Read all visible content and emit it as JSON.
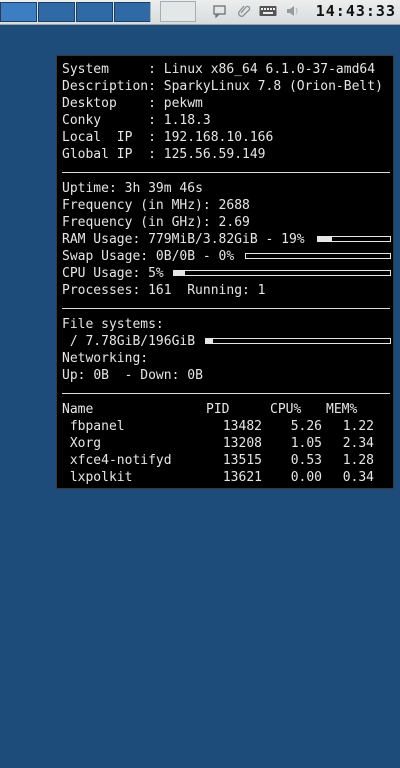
{
  "panel": {
    "clock": "14:43:33",
    "desktops": 4
  },
  "conky": {
    "system": [
      {
        "label": "System     : ",
        "value": "Linux x86_64 6.1.0-37-amd64"
      },
      {
        "label": "Description: ",
        "value": "SparkyLinux 7.8 (Orion-Belt)"
      },
      {
        "label": "Desktop    : ",
        "value": "pekwm"
      },
      {
        "label": "Conky      : ",
        "value": "1.18.3"
      },
      {
        "label": "Local  IP  : ",
        "value": "192.168.10.166"
      },
      {
        "label": "Global IP  : ",
        "value": "125.56.59.149"
      }
    ],
    "uptime": {
      "label": "Uptime: ",
      "value": "3h 39m 46s"
    },
    "freq_mhz": {
      "label": "Frequency (in MHz): ",
      "value": "2688"
    },
    "freq_ghz": {
      "label": "Frequency (in GHz): ",
      "value": "2.69"
    },
    "ram": {
      "label": "RAM Usage: ",
      "value": "779MiB/3.82GiB - 19%",
      "fraction": 0.19
    },
    "swap": {
      "label": "Swap Usage: ",
      "value": "0B/0B - 0%",
      "fraction": 0.0
    },
    "cpu": {
      "label": "CPU Usage: ",
      "value": "5%",
      "fraction": 0.05
    },
    "processes": {
      "label": "Processes: ",
      "value": "161",
      "running_label": "  Running: ",
      "running_value": "1"
    },
    "filesystems": {
      "heading": "File systems:",
      "root_label": " / ",
      "root_value": "7.78GiB/196GiB",
      "fraction": 0.04
    },
    "networking": {
      "heading": "Networking:",
      "up_label": "Up: ",
      "up_value": "0B",
      "down_label": "  - Down: ",
      "down_value": "0B"
    },
    "top": {
      "headers": {
        "name": "Name",
        "pid": "PID",
        "cpu": "CPU%",
        "mem": "MEM%"
      },
      "rows": [
        {
          "name": " fbpanel",
          "pid": "13482",
          "cpu": "5.26",
          "mem": "1.22"
        },
        {
          "name": " Xorg",
          "pid": "13208",
          "cpu": "1.05",
          "mem": "2.34"
        },
        {
          "name": " xfce4-notifyd",
          "pid": "13515",
          "cpu": "0.53",
          "mem": "1.28"
        },
        {
          "name": " lxpolkit",
          "pid": "13621",
          "cpu": "0.00",
          "mem": "0.34"
        }
      ]
    }
  }
}
